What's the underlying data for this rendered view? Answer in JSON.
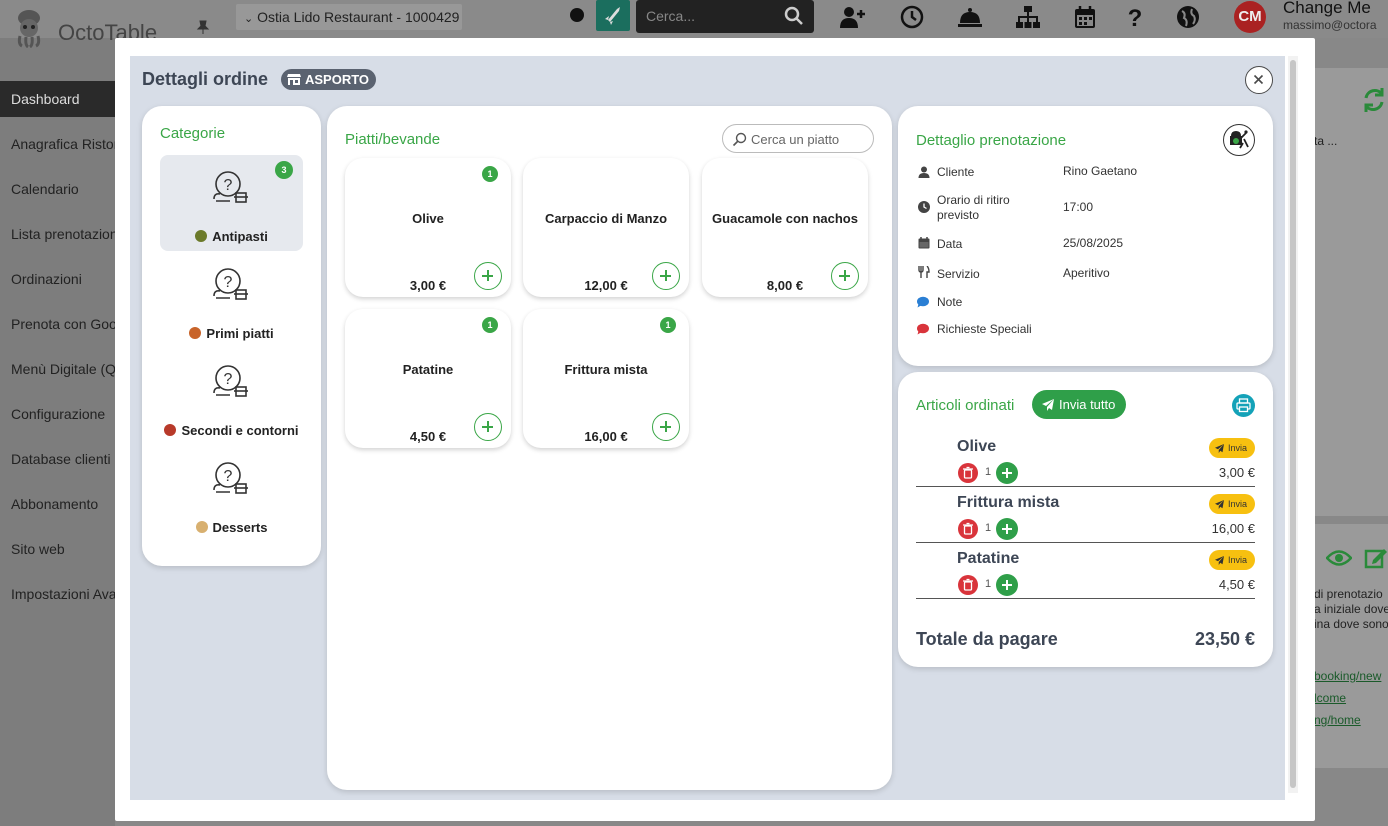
{
  "app": {
    "name": "OctoTable",
    "restaurant": "Ostia Lido Restaurant - 1000429",
    "search_placeholder": "Cerca...",
    "user_initials": "CM",
    "user_name": "Change Me",
    "user_email": "massimo@octora"
  },
  "sidebar": {
    "items": [
      {
        "label": "Dashboard"
      },
      {
        "label": "Anagrafica Ristorante"
      },
      {
        "label": "Calendario"
      },
      {
        "label": "Lista prenotazioni"
      },
      {
        "label": "Ordinazioni"
      },
      {
        "label": "Prenota con Google"
      },
      {
        "label": "Menù Digitale (QR)"
      },
      {
        "label": "Configurazione"
      },
      {
        "label": "Database clienti"
      },
      {
        "label": "Abbonamento"
      },
      {
        "label": "Sito web"
      },
      {
        "label": "Impostazioni Avanzate"
      }
    ]
  },
  "background": {
    "tab_label": "ta ...",
    "text_lines": [
      "di prenotazio",
      "a iniziale dove",
      "ina dove sono"
    ],
    "links": [
      "booking/new",
      "lcome",
      "ng/home"
    ]
  },
  "modal": {
    "title": "Dettagli ordine",
    "badge": "ASPORTO"
  },
  "categories": {
    "title": "Categorie",
    "items": [
      {
        "label": "Antipasti",
        "count": "3",
        "emoji_color": "#6b7a2a"
      },
      {
        "label": "Primi piatti",
        "count": "",
        "emoji_color": "#c8642a"
      },
      {
        "label": "Secondi e contorni",
        "count": "",
        "emoji_color": "#b83a2a"
      },
      {
        "label": "Desserts",
        "count": "",
        "emoji_color": "#d8b070"
      }
    ]
  },
  "dishes": {
    "title": "Piatti/bevande",
    "search_placeholder": "Cerca un piatto",
    "items": [
      {
        "name": "Olive",
        "price": "3,00 €",
        "count": "1"
      },
      {
        "name": "Carpaccio di Manzo",
        "price": "12,00 €",
        "count": ""
      },
      {
        "name": "Guacamole con nachos",
        "price": "8,00 €",
        "count": ""
      },
      {
        "name": "Patatine",
        "price": "4,50 €",
        "count": "1"
      },
      {
        "name": "Frittura mista",
        "price": "16,00 €",
        "count": "1"
      }
    ]
  },
  "booking": {
    "title": "Dettaglio prenotazione",
    "rows": [
      {
        "label": "Cliente",
        "value": "Rino Gaetano",
        "icon": "user-icon"
      },
      {
        "label": "Orario di ritiro previsto",
        "value": "17:00",
        "icon": "clock-icon"
      },
      {
        "label": "Data",
        "value": "25/08/2025",
        "icon": "calendar-icon"
      },
      {
        "label": "Servizio",
        "value": "Aperitivo",
        "icon": "utensils-icon"
      },
      {
        "label": "Note",
        "value": "",
        "icon": "comment-icon",
        "color": "#2a7fd4"
      },
      {
        "label": "Richieste Speciali",
        "value": "",
        "icon": "comment-icon",
        "color": "#d9343b"
      }
    ]
  },
  "ordered": {
    "title": "Articoli ordinati",
    "send_all": "Invia tutto",
    "send_label": "Invia",
    "items": [
      {
        "name": "Olive",
        "qty": "1",
        "price": "3,00 €"
      },
      {
        "name": "Frittura mista",
        "qty": "1",
        "price": "16,00 €"
      },
      {
        "name": "Patatine",
        "qty": "1",
        "price": "4,50 €"
      }
    ],
    "total_label": "Totale da pagare",
    "total_value": "23,50 €"
  },
  "colors": {
    "accent": "#3aa647",
    "send_button": "#2f9f49",
    "warning": "#f7c010",
    "danger": "#d9343b",
    "info": "#14a2b8"
  }
}
